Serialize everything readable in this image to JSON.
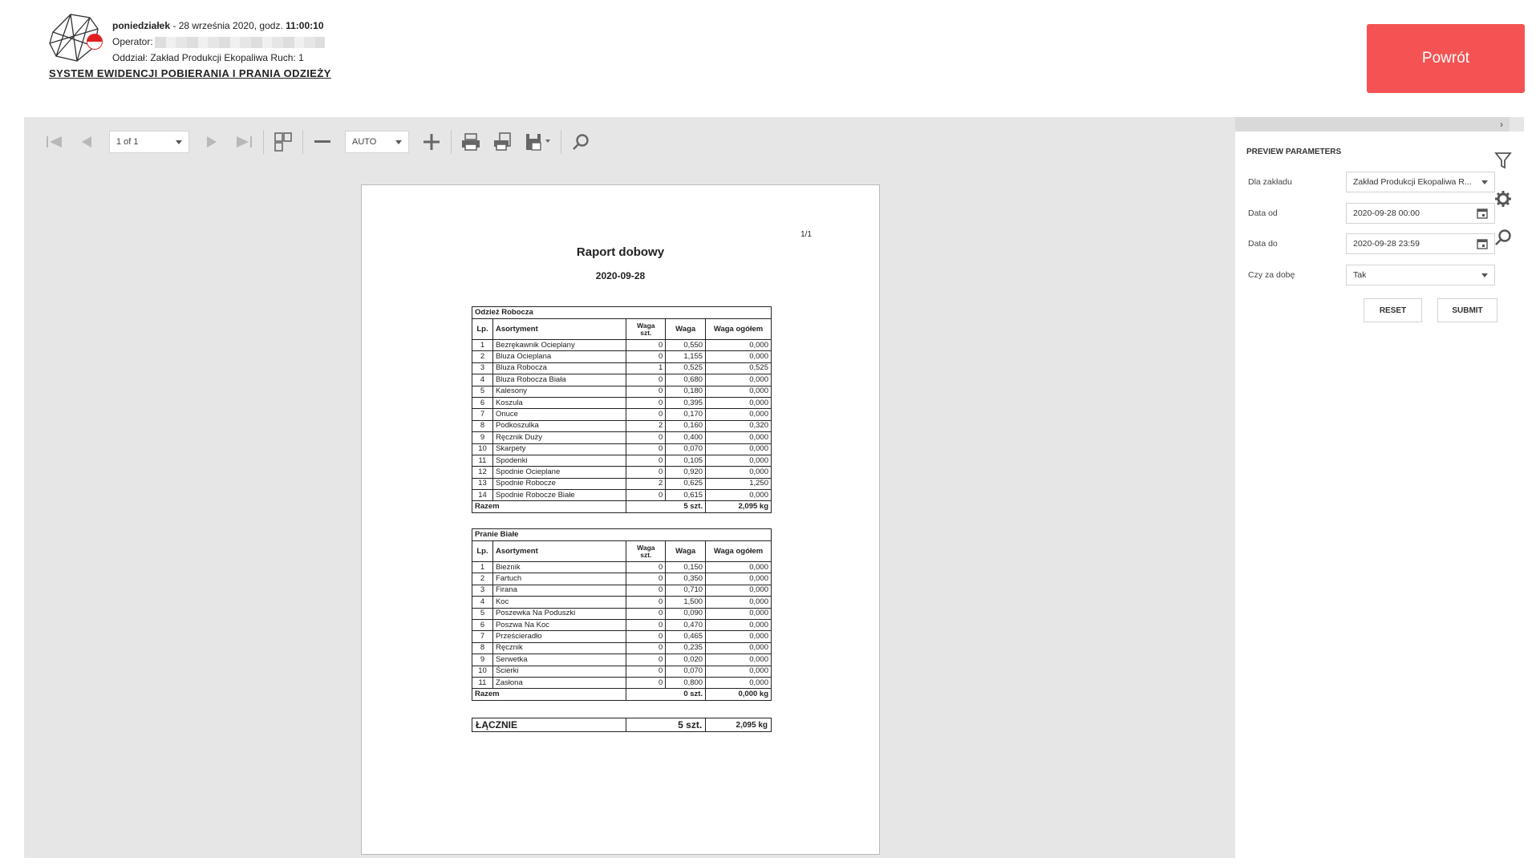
{
  "header": {
    "day": "poniedziałek",
    "date_sep": " - 28 września 2020, godz. ",
    "time": "11:00:10",
    "operator_label": "Operator:",
    "department": "Oddział: Zakład Produkcji Ekopaliwa Ruch: 1",
    "system_title": "SYSTEM EWIDENCJI POBIERANIA I PRANIA ODZIEŻY",
    "back_label": "Powrót"
  },
  "colors": {
    "accent_red": "#f55353",
    "viewer_bg": "#e6e6e6"
  },
  "toolbar": {
    "page_select": "1 of 1",
    "zoom_select": "AUTO",
    "icons": [
      "first-page-icon",
      "prev-page-icon",
      "next-page-icon",
      "last-page-icon",
      "multipage-icon",
      "zoom-out-icon",
      "zoom-in-icon",
      "print-icon",
      "print-page-icon",
      "export-icon",
      "search-icon"
    ]
  },
  "report": {
    "page_num": "1/1",
    "title": "Raport dobowy",
    "date": "2020-09-28",
    "columns": {
      "lp": "Lp.",
      "asort": "Asortyment",
      "waga_szt_1": "Waga",
      "waga_szt_2": "szt.",
      "waga": "Waga",
      "waga_ogolem": "Waga ogółem"
    },
    "sections": [
      {
        "name": "Odzież Robocza",
        "rows": [
          [
            "1",
            "Bezrękawnik Ocieplany",
            "0",
            "0,550",
            "0,000"
          ],
          [
            "2",
            "Bluza Ocieplana",
            "0",
            "1,155",
            "0,000"
          ],
          [
            "3",
            "Bluza Robocza",
            "1",
            "0,525",
            "0,525"
          ],
          [
            "4",
            "Bluza Robocza Biała",
            "0",
            "0,680",
            "0,000"
          ],
          [
            "5",
            "Kalesony",
            "0",
            "0,180",
            "0,000"
          ],
          [
            "6",
            "Koszula",
            "0",
            "0,395",
            "0,000"
          ],
          [
            "7",
            "Onuce",
            "0",
            "0,170",
            "0,000"
          ],
          [
            "8",
            "Podkoszulka",
            "2",
            "0,160",
            "0,320"
          ],
          [
            "9",
            "Ręcznik Duży",
            "0",
            "0,400",
            "0,000"
          ],
          [
            "10",
            "Skarpety",
            "0",
            "0,070",
            "0,000"
          ],
          [
            "11",
            "Spodenki",
            "0",
            "0,105",
            "0,000"
          ],
          [
            "12",
            "Spodnie Ocieplane",
            "0",
            "0,920",
            "0,000"
          ],
          [
            "13",
            "Spodnie Robocze",
            "2",
            "0,625",
            "1,250"
          ],
          [
            "14",
            "Spodnie Robocze Białe",
            "0",
            "0,615",
            "0,000"
          ]
        ],
        "total_label": "Razem",
        "total_qty": "5 szt.",
        "total_weight": "2,095 kg"
      },
      {
        "name": "Pranie Białe",
        "rows": [
          [
            "1",
            "Bieżnik",
            "0",
            "0,150",
            "0,000"
          ],
          [
            "2",
            "Fartuch",
            "0",
            "0,350",
            "0,000"
          ],
          [
            "3",
            "Firana",
            "0",
            "0,710",
            "0,000"
          ],
          [
            "4",
            "Koc",
            "0",
            "1,500",
            "0,000"
          ],
          [
            "5",
            "Poszewka Na Poduszki",
            "0",
            "0,090",
            "0,000"
          ],
          [
            "6",
            "Poszwa Na Koc",
            "0",
            "0,470",
            "0,000"
          ],
          [
            "7",
            "Prześcieradło",
            "0",
            "0,465",
            "0,000"
          ],
          [
            "8",
            "Ręcznik",
            "0",
            "0,235",
            "0,000"
          ],
          [
            "9",
            "Serwetka",
            "0",
            "0,020",
            "0,000"
          ],
          [
            "10",
            "Ścierki",
            "0",
            "0,070",
            "0,000"
          ],
          [
            "11",
            "Zasłona",
            "0",
            "0,800",
            "0,000"
          ]
        ],
        "total_label": "Razem",
        "total_qty": "0 szt.",
        "total_weight": "0,000 kg"
      }
    ],
    "grand": {
      "label": "ŁĄCZNIE",
      "qty": "5 szt.",
      "weight": "2,095 kg"
    }
  },
  "params": {
    "title": "PREVIEW PARAMETERS",
    "fields": [
      {
        "label": "Dla zakładu",
        "value": "Zakład Produkcji Ekopaliwa R...",
        "icon": "caret"
      },
      {
        "label": "Data od",
        "value": "2020-09-28 00:00",
        "icon": "calendar"
      },
      {
        "label": "Data do",
        "value": "2020-09-28 23:59",
        "icon": "calendar"
      },
      {
        "label": "Czy za dobę",
        "value": "Tak",
        "icon": "caret"
      }
    ],
    "reset_label": "RESET",
    "submit_label": "SUBMIT",
    "side_tabs": [
      "filter-icon",
      "gear-icon",
      "search-icon"
    ]
  }
}
